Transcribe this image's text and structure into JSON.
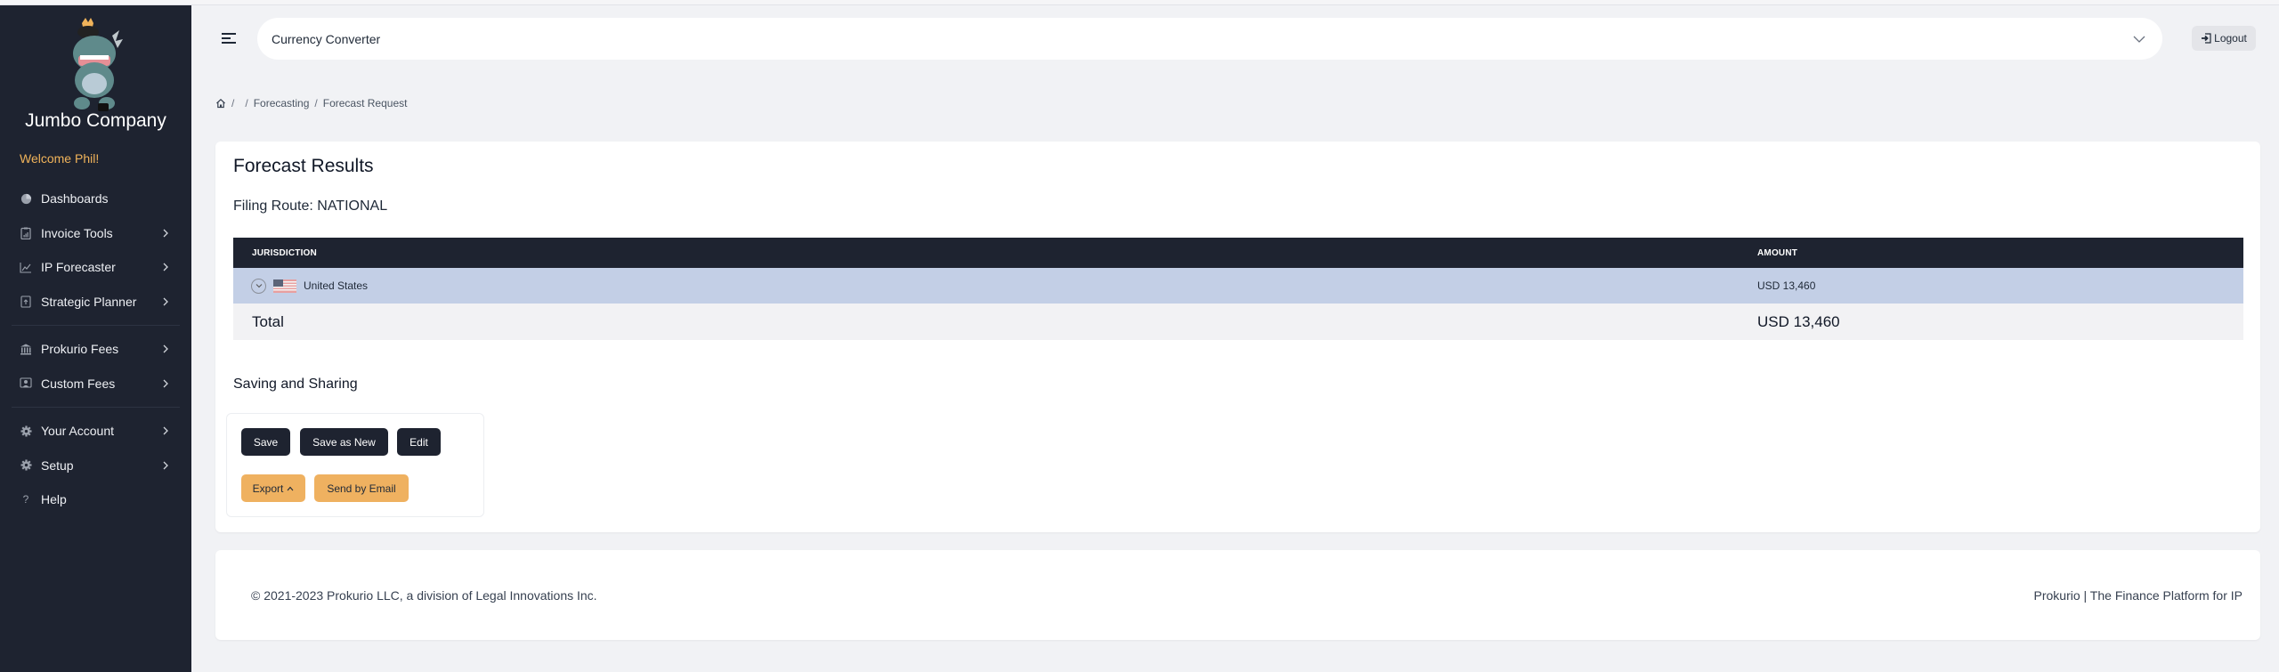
{
  "sidebar": {
    "brand": "Jumbo Company",
    "welcome": "Welcome Phil!",
    "items": [
      {
        "label": "Dashboards",
        "icon": "pie-chart-icon",
        "has_submenu": false
      },
      {
        "label": "Invoice Tools",
        "icon": "invoice-icon",
        "has_submenu": true
      },
      {
        "label": "IP Forecaster",
        "icon": "trend-chart-icon",
        "has_submenu": true
      },
      {
        "label": "Strategic Planner",
        "icon": "planner-icon",
        "has_submenu": true
      },
      {
        "label": "Prokurio Fees",
        "icon": "bank-icon",
        "has_submenu": true
      },
      {
        "label": "Custom Fees",
        "icon": "user-card-icon",
        "has_submenu": true
      },
      {
        "label": "Your Account",
        "icon": "gear-icon",
        "has_submenu": true
      },
      {
        "label": "Setup",
        "icon": "gear-icon",
        "has_submenu": true
      },
      {
        "label": "Help",
        "icon": "question-icon",
        "has_submenu": false
      }
    ]
  },
  "header": {
    "search_value": "Currency Converter",
    "logout_label": "Logout"
  },
  "breadcrumb": {
    "items": [
      "",
      "Forecasting",
      "Forecast Request"
    ],
    "separator": "/"
  },
  "main": {
    "title": "Forecast Results",
    "filing_route": "Filing Route: NATIONAL",
    "table": {
      "columns": [
        "JURISDICTION",
        "AMOUNT"
      ],
      "rows": [
        {
          "jurisdiction": "United States",
          "amount": "USD 13,460"
        }
      ],
      "total_label": "Total",
      "total_amount": "USD 13,460"
    },
    "saving_title": "Saving and Sharing",
    "buttons": {
      "save": "Save",
      "save_as_new": "Save as New",
      "edit": "Edit",
      "export": "Export",
      "send_email": "Send by Email"
    }
  },
  "footer": {
    "copyright": "© 2021-2023 Prokurio LLC, a division of Legal Innovations Inc.",
    "tagline": "Prokurio | The Finance Platform for IP"
  },
  "colors": {
    "sidebar_bg": "#1e2330",
    "accent_orange": "#efb160",
    "welcome_text": "#f0b35a",
    "row_highlight": "#c3cfe6"
  }
}
